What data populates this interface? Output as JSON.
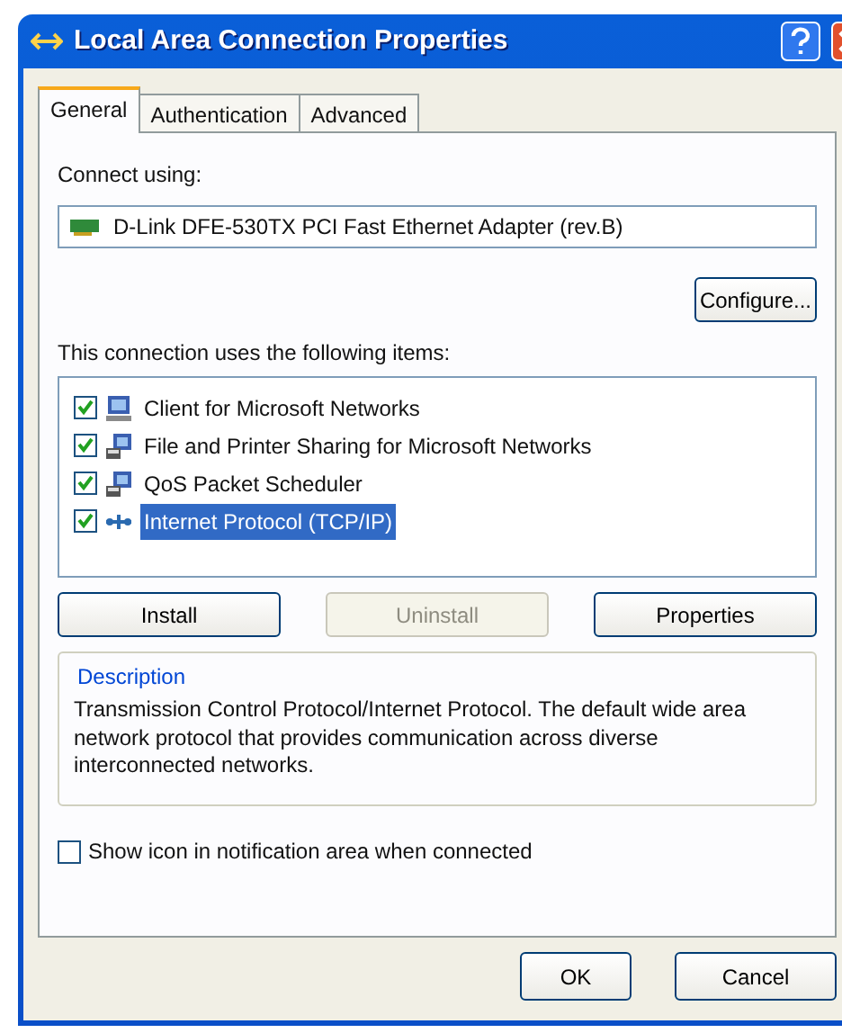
{
  "window": {
    "title": "Local Area Connection Properties"
  },
  "tabs": [
    {
      "label": "General",
      "selected": true
    },
    {
      "label": "Authentication",
      "selected": false
    },
    {
      "label": "Advanced",
      "selected": false
    }
  ],
  "connect_using": {
    "label": "Connect using:",
    "adapter": "D-Link DFE-530TX PCI Fast Ethernet Adapter (rev.B)",
    "button": "Configure..."
  },
  "components": {
    "label": "This connection uses the following items:",
    "items": [
      {
        "label": "Client for Microsoft Networks",
        "checked": true,
        "selected": false,
        "kind": "client"
      },
      {
        "label": "File and Printer Sharing for Microsoft Networks",
        "checked": true,
        "selected": false,
        "kind": "service"
      },
      {
        "label": "QoS Packet Scheduler",
        "checked": true,
        "selected": false,
        "kind": "service"
      },
      {
        "label": "Internet Protocol (TCP/IP)",
        "checked": true,
        "selected": true,
        "kind": "protocol"
      }
    ]
  },
  "buttons": [
    {
      "label": "Install",
      "disabled": false
    },
    {
      "label": "Uninstall",
      "disabled": true
    },
    {
      "label": "Properties",
      "disabled": false
    }
  ],
  "description": {
    "title": "Description",
    "text": "Transmission Control Protocol/Internet Protocol. The default wide area network protocol that provides communication across diverse interconnected networks."
  },
  "show_icon": {
    "label": "Show icon in notification area when connected",
    "checked": false
  },
  "dialog_buttons": [
    "OK",
    "Cancel"
  ]
}
